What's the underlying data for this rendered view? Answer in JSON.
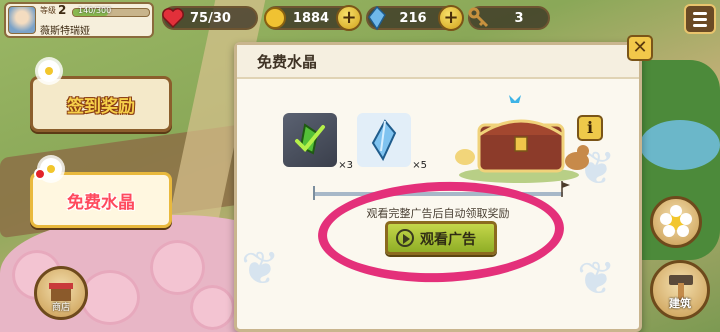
{
  "player": {
    "level_label": "等级",
    "level": "2",
    "xp_text": "140/300",
    "xp_progress": 0.4667,
    "name": "薇斯特瑞娅"
  },
  "resources": {
    "hearts": "75/30",
    "coins": "1884",
    "crystals": "216",
    "keys": "3"
  },
  "side_buttons": {
    "signin_reward": "签到奖励",
    "free_crystal": "免费水晶"
  },
  "shop_label": "商店",
  "modal": {
    "title": "免费水晶",
    "rewards": [
      {
        "name": "green-crystal",
        "qty": "×3"
      },
      {
        "name": "blue-crystal",
        "qty": "×5"
      }
    ],
    "hint": "观看完整广告后自动领取奖励",
    "watch_button": "观看广告",
    "info_button": "i"
  },
  "build_label": "建筑",
  "colors": {
    "accent_ring": "#e4307a",
    "button_green": "#a9c43a"
  }
}
